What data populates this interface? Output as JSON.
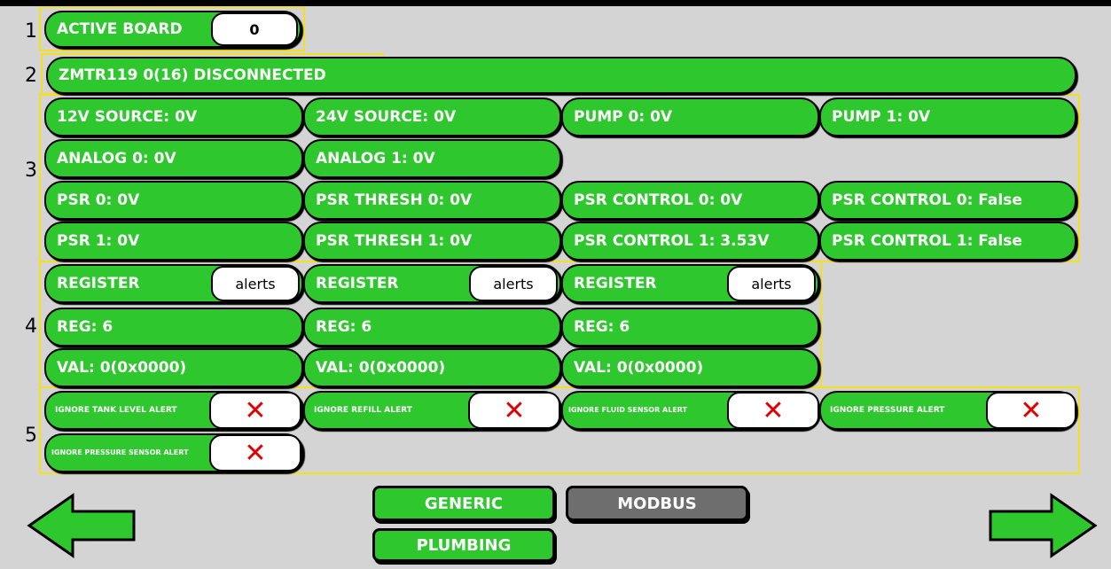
{
  "section_numbers": [
    "1",
    "2",
    "3",
    "4",
    "5"
  ],
  "active_board": {
    "label": "ACTIVE BOARD",
    "value": "0"
  },
  "device_status": "ZMTR119 0(16) DISCONNECTED",
  "readings": [
    "12V SOURCE: 0V",
    "24V SOURCE: 0V",
    "PUMP 0: 0V",
    "PUMP 1: 0V",
    "ANALOG 0: 0V",
    "ANALOG 1: 0V",
    "PSR 0: 0V",
    "PSR THRESH 0: 0V",
    "PSR CONTROL 0: 0V",
    "PSR CONTROL 0: False",
    "PSR 1: 0V",
    "PSR THRESH 1: 0V",
    "PSR CONTROL 1: 3.53V",
    "PSR CONTROL 1: False"
  ],
  "registers": [
    {
      "label": "REGISTER",
      "value": "alerts",
      "reg": "REG: 6",
      "val": "VAL: 0(0x0000)"
    },
    {
      "label": "REGISTER",
      "value": "alerts",
      "reg": "REG: 6",
      "val": "VAL: 0(0x0000)"
    },
    {
      "label": "REGISTER",
      "value": "alerts",
      "reg": "REG: 6",
      "val": "VAL: 0(0x0000)"
    }
  ],
  "ignore_alerts": [
    {
      "label": "IGNORE TANK LEVEL ALERT",
      "state": "✕"
    },
    {
      "label": "IGNORE REFILL ALERT",
      "state": "✕"
    },
    {
      "label": "IGNORE FLUID SENSOR ALERT",
      "state": "✕"
    },
    {
      "label": "IGNORE PRESSURE ALERT",
      "state": "✕"
    },
    {
      "label": "IGNORE PRESSURE SENSOR ALERT",
      "state": "✕"
    }
  ],
  "tabs": {
    "generic": "GENERIC",
    "modbus": "MODBUS",
    "plumbing": "PLUMBING"
  },
  "nav": {
    "prev_icon": "left-arrow-icon",
    "next_icon": "right-arrow-icon"
  },
  "colors": {
    "accent_green": "#2ec82e",
    "highlight_yellow": "#f5e01c",
    "inactive_gray": "#6e6e6e",
    "x_red": "#e00000"
  }
}
